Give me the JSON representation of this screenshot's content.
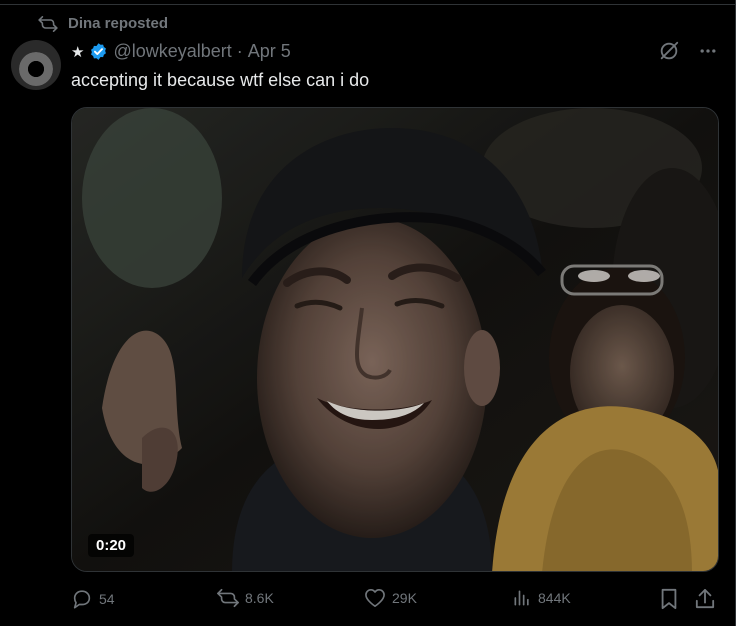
{
  "repost": {
    "label": "Dina reposted",
    "icon": "repost-icon"
  },
  "post": {
    "display_name": "★",
    "verified": true,
    "handle": "@lowkeyalbert",
    "separator": "·",
    "date": "Apr 5",
    "text": "accepting it because wtf else can i do",
    "media": {
      "type": "video",
      "duration": "0:20"
    }
  },
  "stats": {
    "replies": "54",
    "reposts": "8.6K",
    "likes": "29K",
    "views": "844K"
  },
  "icons": {
    "grok": "grok-icon",
    "more": "more-icon",
    "reply": "reply-icon",
    "repost": "repost-icon",
    "like": "heart-icon",
    "views": "views-icon",
    "bookmark": "bookmark-icon",
    "share": "share-icon"
  },
  "colors": {
    "background": "#000000",
    "text": "#e7e9ea",
    "muted": "#71767b",
    "verified": "#1d9bf0"
  }
}
